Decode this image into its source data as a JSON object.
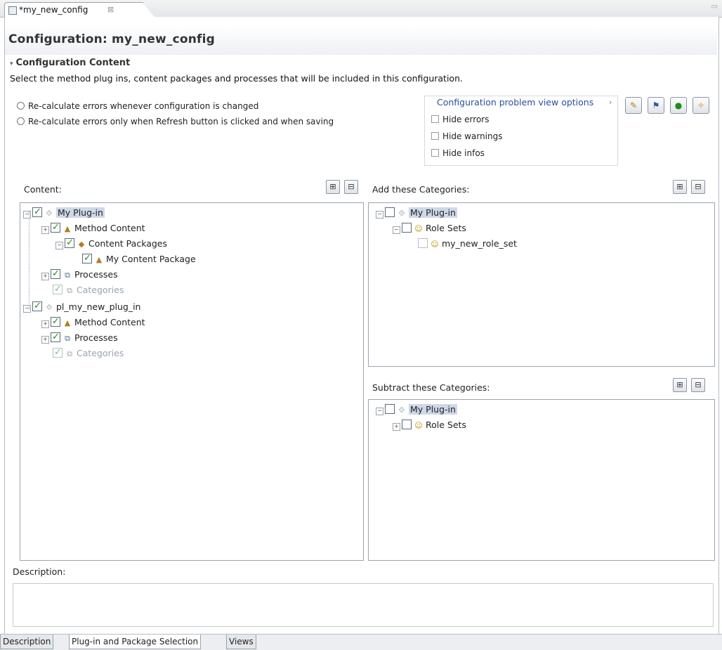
{
  "editor_tab": {
    "label": "*my_new_config",
    "close": "⊠"
  },
  "form": {
    "title": "Configuration: my_new_config"
  },
  "section": {
    "title": "Configuration Content",
    "description": "Select the method plug ins, content packages and processes that will be included in this configuration."
  },
  "radios": [
    "Re-calculate errors whenever configuration is changed",
    "Re-calculate errors only when Refresh button is clicked and when saving"
  ],
  "view_options": {
    "link": "Configuration problem view options",
    "checkboxes": [
      "Hide errors",
      "Hide warnings",
      "Hide infos"
    ]
  },
  "content_panel": {
    "label": "Content:",
    "tree": [
      {
        "label": "My Plug-in",
        "icon": "plugin-icon"
      },
      {
        "label": "Method Content",
        "icon": "method-content-icon"
      },
      {
        "label": "Content Packages",
        "icon": "package-icon"
      },
      {
        "label": "My Content Package",
        "icon": "content-package-icon"
      },
      {
        "label": "Processes",
        "icon": "processes-icon"
      },
      {
        "label": "Categories",
        "icon": "categories-icon"
      },
      {
        "label": "pl_my_new_plug_in",
        "icon": "plugin-icon"
      },
      {
        "label": "Method Content",
        "icon": "method-content-icon"
      },
      {
        "label": "Processes",
        "icon": "processes-icon"
      },
      {
        "label": "Categories",
        "icon": "categories-icon"
      }
    ]
  },
  "add_panel": {
    "label": "Add these Categories:",
    "tree": [
      {
        "label": "My Plug-in",
        "icon": "plugin-icon"
      },
      {
        "label": "Role Sets",
        "icon": "role-sets-icon"
      },
      {
        "label": "my_new_role_set",
        "icon": "role-set-icon"
      }
    ]
  },
  "subtract_panel": {
    "label": "Subtract these Categories:",
    "tree": [
      {
        "label": "My Plug-in",
        "icon": "plugin-icon"
      },
      {
        "label": "Role Sets",
        "icon": "role-sets-icon"
      }
    ]
  },
  "description": {
    "label": "Description:"
  },
  "bottom_tabs": [
    "Description",
    "Plug-in and Package Selection",
    "Views"
  ],
  "colors": {
    "link": "#2a4f9f",
    "check": "#1f8b1f",
    "selection": "#cfd8e8"
  }
}
